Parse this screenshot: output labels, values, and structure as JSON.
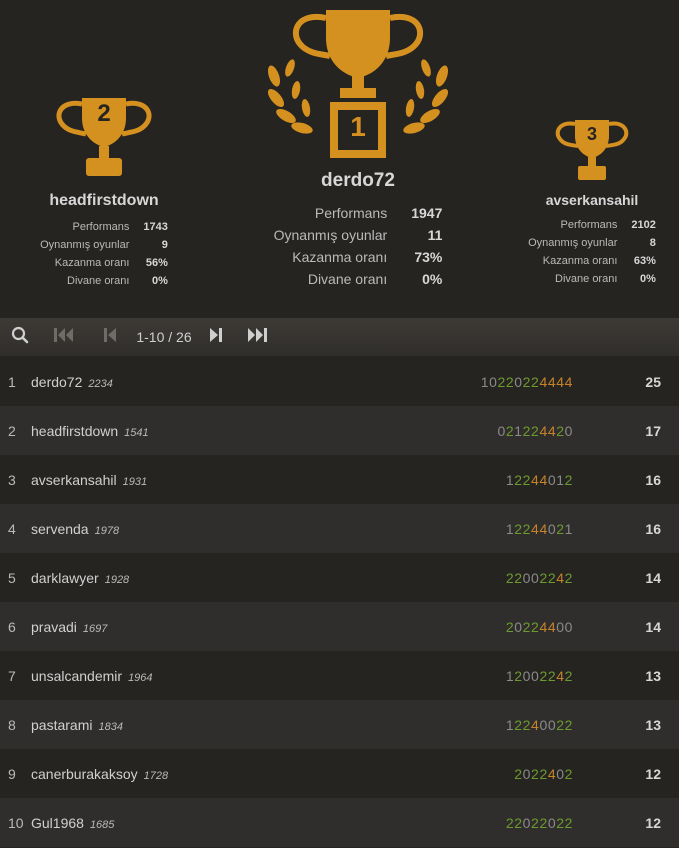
{
  "podium": {
    "first": {
      "rank_label": "1",
      "name": "derdo72",
      "stats": [
        {
          "label": "Performans",
          "value": "1947"
        },
        {
          "label": "Oynanmış oyunlar",
          "value": "11"
        },
        {
          "label": "Kazanma oranı",
          "value": "73%"
        },
        {
          "label": "Divane oranı",
          "value": "0%"
        }
      ]
    },
    "second": {
      "rank_label": "2",
      "name": "headfirstdown",
      "stats": [
        {
          "label": "Performans",
          "value": "1743"
        },
        {
          "label": "Oynanmış oyunlar",
          "value": "9"
        },
        {
          "label": "Kazanma oranı",
          "value": "56%"
        },
        {
          "label": "Divane oranı",
          "value": "0%"
        }
      ]
    },
    "third": {
      "rank_label": "3",
      "name": "avserkansahil",
      "stats": [
        {
          "label": "Performans",
          "value": "2102"
        },
        {
          "label": "Oynanmış oyunlar",
          "value": "8"
        },
        {
          "label": "Kazanma oranı",
          "value": "63%"
        },
        {
          "label": "Divane oranı",
          "value": "0%"
        }
      ]
    }
  },
  "colors": {
    "trophy": "#d59120",
    "score_win": "#c8832a",
    "score_draw": "#6d9a2e",
    "score_other": "#8a8a8a"
  },
  "toolbar": {
    "pager_text": "1-10 / 26",
    "icons": [
      "search-icon",
      "first-page-icon",
      "prev-page-icon",
      "next-page-icon",
      "last-page-icon"
    ]
  },
  "rows": [
    {
      "rank": "1",
      "name": "derdo72",
      "rating": "2234",
      "scores": "10220224444",
      "total": "25"
    },
    {
      "rank": "2",
      "name": "headfirstdown",
      "rating": "1541",
      "scores": "021224420",
      "total": "17"
    },
    {
      "rank": "3",
      "name": "avserkansahil",
      "rating": "1931",
      "scores": "12244012",
      "total": "16"
    },
    {
      "rank": "4",
      "name": "servenda",
      "rating": "1978",
      "scores": "12244021",
      "total": "16"
    },
    {
      "rank": "5",
      "name": "darklawyer",
      "rating": "1928",
      "scores": "22002242",
      "total": "14"
    },
    {
      "rank": "6",
      "name": "pravadi",
      "rating": "1697",
      "scores": "20224400",
      "total": "14"
    },
    {
      "rank": "7",
      "name": "unsalcandemir",
      "rating": "1964",
      "scores": "12002242",
      "total": "13"
    },
    {
      "rank": "8",
      "name": "pastarami",
      "rating": "1834",
      "scores": "12240022",
      "total": "13"
    },
    {
      "rank": "9",
      "name": "canerburakaksoy",
      "rating": "1728",
      "scores": "2022402",
      "total": "12"
    },
    {
      "rank": "10",
      "name": "Gul1968",
      "rating": "1685",
      "scores": "22022022",
      "total": "12"
    }
  ]
}
